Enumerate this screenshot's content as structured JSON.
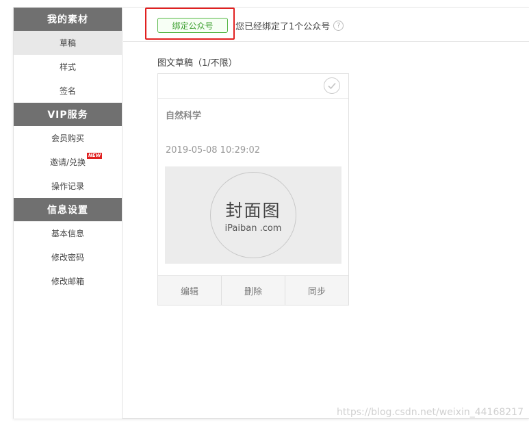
{
  "sidebar": {
    "groups": [
      {
        "title": "我的素材",
        "items": [
          {
            "label": "草稿"
          },
          {
            "label": "样式"
          },
          {
            "label": "签名"
          }
        ]
      },
      {
        "title": "VIP服务",
        "items": [
          {
            "label": "会员购买"
          },
          {
            "label": "邀请/兑换",
            "badge": "NEW"
          },
          {
            "label": "操作记录"
          }
        ]
      },
      {
        "title": "信息设置",
        "items": [
          {
            "label": "基本信息"
          },
          {
            "label": "修改密码"
          },
          {
            "label": "修改邮箱"
          }
        ]
      }
    ]
  },
  "bind": {
    "button_label": "绑定公众号",
    "status_text": "您已经绑定了1个公众号",
    "help_icon": "?"
  },
  "drafts": {
    "title": "图文草稿（1/不限）",
    "cards": [
      {
        "title": "自然科学",
        "time": "2019-05-08 10:29:02",
        "cover_main": "封面图",
        "cover_sub": "iPaiban .com",
        "actions": {
          "edit": "编辑",
          "delete": "删除",
          "sync": "同步"
        }
      }
    ]
  },
  "watermark": "https://blog.csdn.net/weixin_44168217",
  "colors": {
    "sidebar_header": "#707070",
    "bind_green": "#52b543",
    "highlight_red": "#e12020"
  }
}
